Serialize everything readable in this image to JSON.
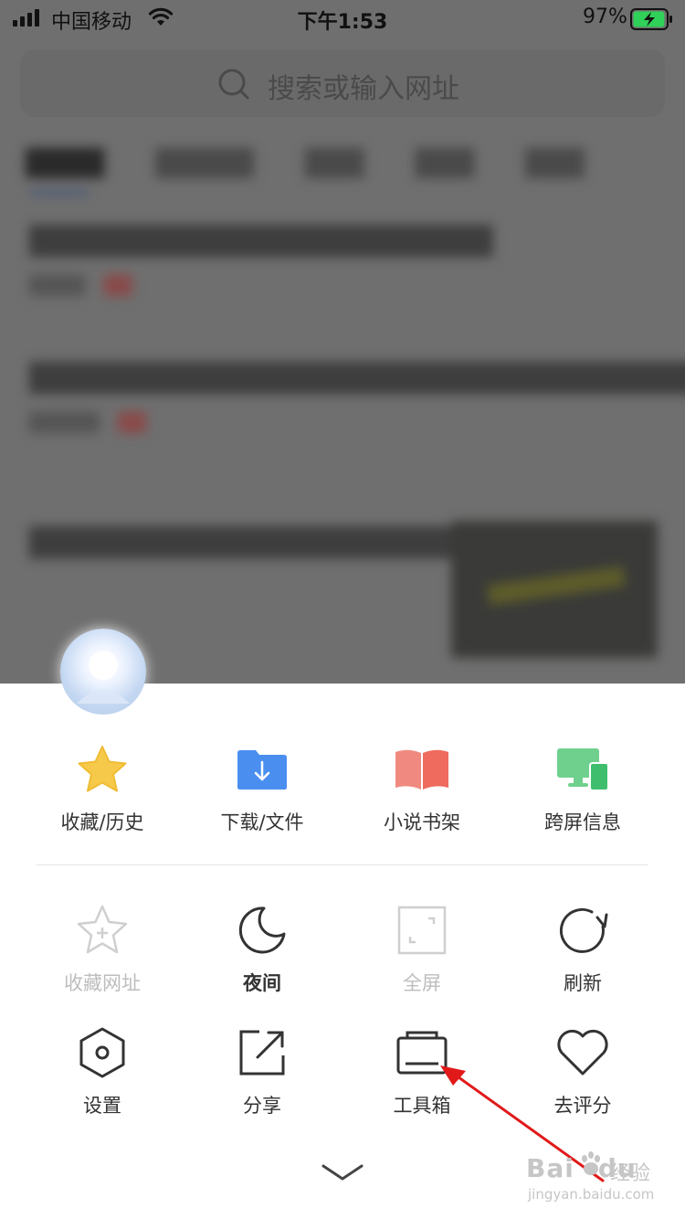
{
  "status_bar": {
    "carrier": "中国移动",
    "time": "下午1:53",
    "battery_percent": "97%",
    "battery_level": 0.97,
    "charging_color": "#30d158"
  },
  "background_page": {
    "search_placeholder": "搜索或输入网址"
  },
  "sheet": {
    "top_row": [
      {
        "label": "收藏/历史",
        "icon": "star-icon",
        "color": "#f7c94a"
      },
      {
        "label": "下载/文件",
        "icon": "download-folder-icon",
        "color": "#4a8ff0"
      },
      {
        "label": "小说书架",
        "icon": "open-book-icon",
        "color": "#ee6b5e"
      },
      {
        "label": "跨屏信息",
        "icon": "multi-screen-icon",
        "color": "#3fbf6d"
      }
    ],
    "row2": [
      {
        "label": "收藏网址",
        "icon": "star-plus-icon",
        "state": "disabled"
      },
      {
        "label": "夜间",
        "icon": "moon-icon",
        "state": "active"
      },
      {
        "label": "全屏",
        "icon": "fullscreen-icon",
        "state": "disabled"
      },
      {
        "label": "刷新",
        "icon": "refresh-icon",
        "state": "enabled"
      }
    ],
    "row3": [
      {
        "label": "设置",
        "icon": "hexagon-settings-icon"
      },
      {
        "label": "分享",
        "icon": "share-icon"
      },
      {
        "label": "工具箱",
        "icon": "toolbox-icon"
      },
      {
        "label": "去评分",
        "icon": "heart-icon"
      }
    ]
  },
  "annotation": {
    "arrow_color": "#e11919"
  },
  "watermark": {
    "brand": "Bai",
    "brand_suffix": "du",
    "product": "经验",
    "url": "jingyan.baidu.com"
  }
}
